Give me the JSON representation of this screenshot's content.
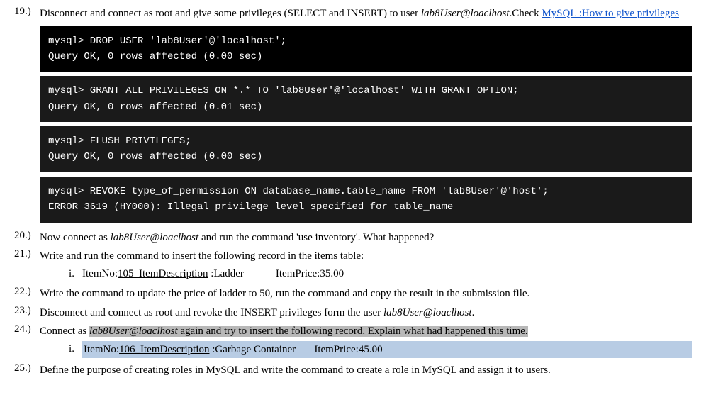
{
  "items": [
    {
      "number": "19.)",
      "text_parts": [
        {
          "text": "Disconnect and connect as root and give some privileges (SELECT and INSERT) to user ",
          "style": "normal"
        },
        {
          "text": "lab8User@loaclhost",
          "style": "italic"
        },
        {
          "text": ".Check ",
          "style": "normal"
        },
        {
          "text": "MySQL :How to give privileges",
          "style": "link"
        }
      ],
      "terminals": [
        {
          "type": "outer",
          "lines": [
            "mysql> DROP USER 'lab8User'@'localhost';",
            "Query OK, 0 rows affected (0.00 sec)"
          ]
        },
        {
          "type": "inner",
          "lines": [
            "mysql> GRANT ALL PRIVILEGES ON *.* TO 'lab8User'@'localhost' WITH GRANT OPTION;",
            "Query OK, 0 rows affected (0.01 sec)"
          ]
        },
        {
          "type": "inner",
          "lines": [
            "mysql> FLUSH PRIVILEGES;",
            "Query OK, 0 rows affected (0.00 sec)"
          ]
        },
        {
          "type": "inner",
          "lines": [
            "mysql> REVOKE type_of_permission ON database_name.table_name FROM 'lab8User'@'host';",
            "ERROR 3619 (HY000): Illegal privilege level specified for table_name"
          ]
        }
      ]
    },
    {
      "number": "20.)",
      "text_parts": [
        {
          "text": "Now connect as ",
          "style": "normal"
        },
        {
          "text": "lab8User@loaclhost",
          "style": "italic"
        },
        {
          "text": " and run the command ‘use inventory’. What happened?",
          "style": "normal"
        }
      ]
    },
    {
      "number": "21.)",
      "text_parts": [
        {
          "text": "Write and run the command to insert the following record in the items table:",
          "style": "normal"
        }
      ],
      "subitems": [
        {
          "roman": "i.",
          "parts": [
            {
              "text": "ItemNo:",
              "style": "normal"
            },
            {
              "text": "105_ItemDescription",
              "style": "underline"
            },
            {
              "text": " :Ladder",
              "style": "normal"
            },
            {
              "text": "            ItemPrice:35.00",
              "style": "normal"
            }
          ]
        }
      ]
    },
    {
      "number": "22.)",
      "text_parts": [
        {
          "text": "Write the command to update the price of ladder to 50, run the command and copy the result in the submission file.",
          "style": "normal"
        }
      ]
    },
    {
      "number": "23.)",
      "text_parts": [
        {
          "text": "Disconnect and connect as root and revoke the INSERT privileges form the user ",
          "style": "normal"
        },
        {
          "text": "lab8User@loaclhost",
          "style": "italic"
        },
        {
          "text": ".",
          "style": "normal"
        }
      ]
    },
    {
      "number": "24.)",
      "text_parts": [
        {
          "text": "Connect as ",
          "style": "normal"
        },
        {
          "text": "lab8User@loaclhost",
          "style": "italic-highlight"
        },
        {
          "text": " again and try to insert the following record. Explain what had happened this time.",
          "style": "highlight"
        }
      ],
      "subitems": [
        {
          "roman": "i.",
          "highlight": true,
          "parts": [
            {
              "text": "ItemNo:",
              "style": "normal"
            },
            {
              "text": "106_ItemDescription",
              "style": "underline"
            },
            {
              "text": " :Garbage Container",
              "style": "normal"
            },
            {
              "text": "        ItemPrice:45.00",
              "style": "normal"
            }
          ]
        }
      ]
    },
    {
      "number": "25.)",
      "text_parts": [
        {
          "text": "Define the purpose of creating roles in MySQL and write the command to create a role in MySQL and assign it to users.",
          "style": "normal"
        }
      ]
    }
  ],
  "link_text": "MySQL :How to give privileges"
}
